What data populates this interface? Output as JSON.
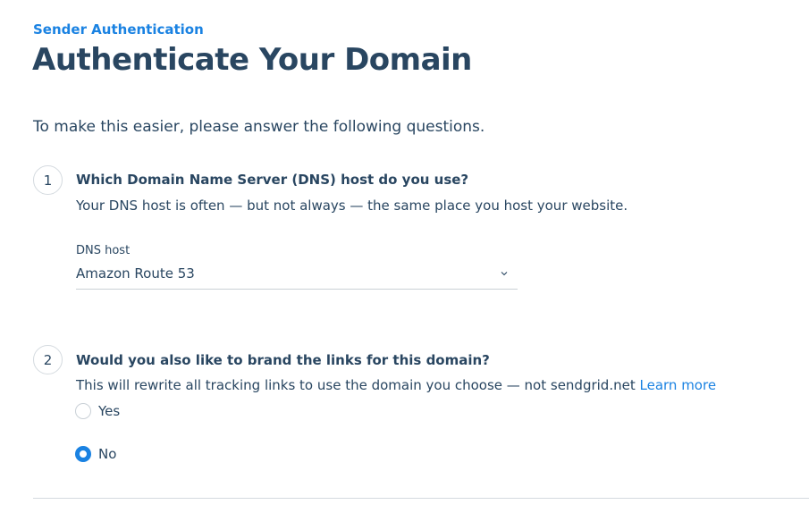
{
  "header": {
    "breadcrumb": "Sender Authentication",
    "title": "Authenticate Your Domain"
  },
  "intro": "To make this easier, please answer the following questions.",
  "steps": [
    {
      "number": "1",
      "question": "Which Domain Name Server (DNS) host do you use?",
      "description": "Your DNS host is often — but not always — the same place you host your website.",
      "select": {
        "label": "DNS host",
        "value": "Amazon Route 53",
        "icon": "chevron-down-icon"
      }
    },
    {
      "number": "2",
      "question": "Would you also like to brand the links for this domain?",
      "description": "This will rewrite all tracking links to use the domain you choose — not sendgrid.net",
      "link": "Learn more",
      "options": [
        {
          "label": "Yes",
          "selected": false
        },
        {
          "label": "No",
          "selected": true
        }
      ]
    }
  ],
  "colors": {
    "accent": "#1a82e2",
    "text": "#294661",
    "border": "#d4dadf"
  }
}
